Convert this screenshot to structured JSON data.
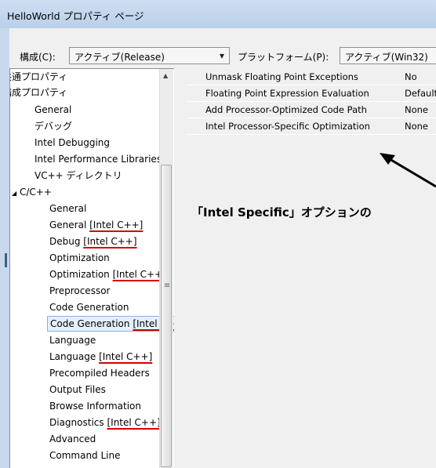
{
  "window": {
    "title": "HelloWorld プロパティ ページ"
  },
  "toolbar": {
    "config_label": "構成(C):",
    "config_value": "アクティブ(Release)",
    "platform_label": "プラットフォーム(P):",
    "platform_value": "アクティブ(Win32)"
  },
  "tree": {
    "items": [
      {
        "label": "共通プロパティ"
      },
      {
        "label": "構成プロパティ"
      },
      {
        "label": "General"
      },
      {
        "label": "デバッグ"
      },
      {
        "label": "Intel Debugging"
      },
      {
        "label": "Intel Performance Libraries"
      },
      {
        "label": "VC++ ディレクトリ"
      },
      {
        "label": "C/C++"
      },
      {
        "label": "General"
      },
      {
        "label": "General",
        "tag": "[Intel C++]"
      },
      {
        "label": "Debug",
        "tag": "[Intel C++]"
      },
      {
        "label": "Optimization"
      },
      {
        "label": "Optimization",
        "tag": "[Intel C++]"
      },
      {
        "label": "Preprocessor"
      },
      {
        "label": "Code Generation"
      },
      {
        "label": "Code Generation",
        "tag": "[Intel C++]"
      },
      {
        "label": "Language"
      },
      {
        "label": "Language",
        "tag": "[Intel C++]"
      },
      {
        "label": "Precompiled Headers"
      },
      {
        "label": "Output Files"
      },
      {
        "label": "Browse Information"
      },
      {
        "label": "Diagnostics",
        "tag": "[Intel C++]"
      },
      {
        "label": "Advanced"
      },
      {
        "label": "Command Line"
      }
    ],
    "expander_glyph": "◢"
  },
  "properties": [
    {
      "name": "Unmask Floating Point Exceptions",
      "value": "No"
    },
    {
      "name": "Floating Point Expression Evaluation",
      "value": "Default"
    },
    {
      "name": "Add Processor-Optimized Code Path",
      "value": "None"
    },
    {
      "name": "Intel Processor-Specific Optimization",
      "value": "None"
    }
  ],
  "annotation": {
    "text": "「Intel Specific」オプションの"
  },
  "colors": {
    "accent": "#000000",
    "underline": "#d40000",
    "selection": "#e6f0fb"
  }
}
